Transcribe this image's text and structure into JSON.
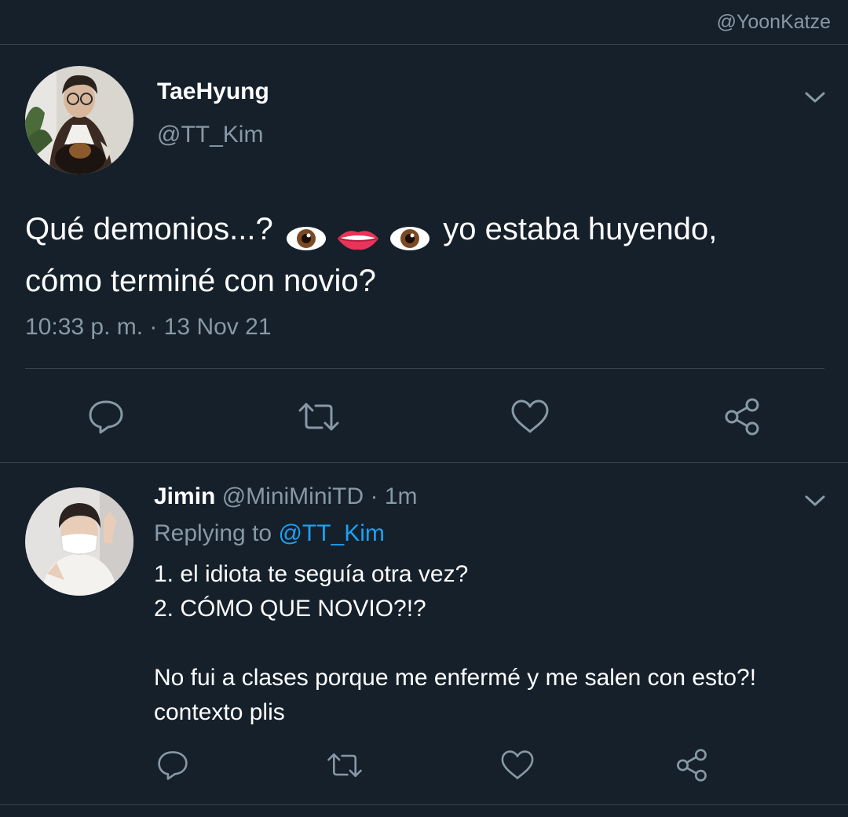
{
  "watermark": "@YoonKatze",
  "main_tweet": {
    "display_name": "TaeHyung",
    "handle": "@TT_Kim",
    "text_before_emoji": "Qué demonios...?",
    "emoji": [
      "eyes-emoji",
      "lips-emoji",
      "eyes-emoji"
    ],
    "text_after_emoji": "yo estaba huyendo,",
    "text_line2": "cómo terminé con novio?",
    "timestamp": "10:33 p. m. · 13 Nov 21"
  },
  "reply_tweet": {
    "display_name": "Jimin",
    "handle_and_time": "@MiniMiniTD · 1m",
    "replying_prefix": "Replying to",
    "replying_mention": "@TT_Kim",
    "body_lines": [
      "1. el idiota te seguía otra vez?",
      "2. CÓMO QUE NOVIO?!?",
      "",
      "No fui a clases porque me enfermé y me salen con esto?!",
      "contexto plis"
    ]
  },
  "actions": [
    "reply-icon",
    "retweet-icon",
    "like-icon",
    "share-icon"
  ],
  "colors": {
    "background": "#15202b",
    "secondary_text": "#8899a6",
    "link": "#1da1f2",
    "divider": "#38444d"
  }
}
